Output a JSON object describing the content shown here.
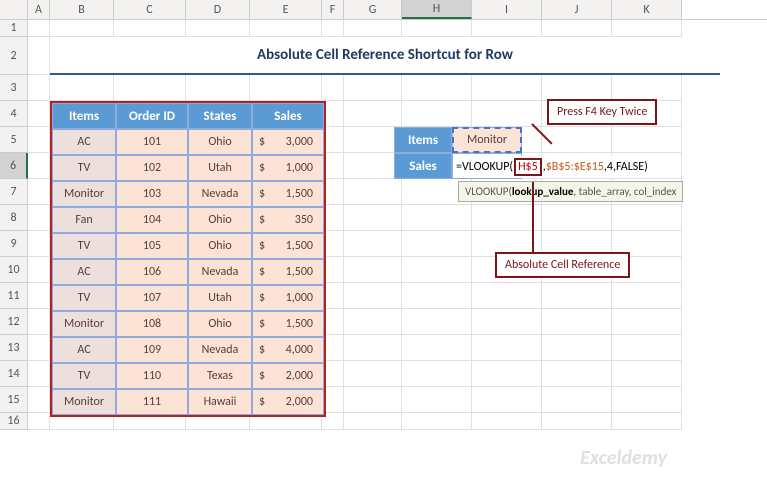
{
  "title": "Absolute Cell Reference Shortcut for Row",
  "columns": [
    "A",
    "B",
    "C",
    "D",
    "E",
    "F",
    "G",
    "H",
    "I",
    "J",
    "K"
  ],
  "row_numbers": [
    "1",
    "2",
    "3",
    "4",
    "5",
    "6",
    "7",
    "8",
    "9",
    "10",
    "11",
    "12",
    "13",
    "14",
    "15",
    "16"
  ],
  "headers": {
    "items": "Items",
    "order_id": "Order ID",
    "states": "States",
    "sales": "Sales"
  },
  "rows": [
    {
      "item": "AC",
      "order": "101",
      "state": "Ohio",
      "currency": "$",
      "sales": "3,000"
    },
    {
      "item": "TV",
      "order": "102",
      "state": "Utah",
      "currency": "$",
      "sales": "1,000"
    },
    {
      "item": "Monitor",
      "order": "103",
      "state": "Nevada",
      "currency": "$",
      "sales": "1,500"
    },
    {
      "item": "Fan",
      "order": "104",
      "state": "Ohio",
      "currency": "$",
      "sales": "350"
    },
    {
      "item": "TV",
      "order": "105",
      "state": "Ohio",
      "currency": "$",
      "sales": "1,500"
    },
    {
      "item": "AC",
      "order": "106",
      "state": "Nevada",
      "currency": "$",
      "sales": "1,500"
    },
    {
      "item": "TV",
      "order": "107",
      "state": "Utah",
      "currency": "$",
      "sales": "1,000"
    },
    {
      "item": "Monitor",
      "order": "108",
      "state": "Ohio",
      "currency": "$",
      "sales": "1,500"
    },
    {
      "item": "AC",
      "order": "109",
      "state": "Nevada",
      "currency": "$",
      "sales": "4,000"
    },
    {
      "item": "TV",
      "order": "110",
      "state": "Texas",
      "currency": "$",
      "sales": "2,000"
    },
    {
      "item": "Monitor",
      "order": "111",
      "state": "Hawaii",
      "currency": "$",
      "sales": "2,000"
    }
  ],
  "lookup": {
    "items_label": "Items",
    "sales_label": "Sales",
    "items_value": "Monitor"
  },
  "formula": {
    "prefix": "=VLOOKUP(",
    "arg1": "H$5",
    "sep": ",",
    "arg2": "$B$5:$E$15",
    "rest": ",4,FALSE)"
  },
  "tooltip": {
    "fn": "VLOOKUP(",
    "active": "lookup_value",
    "rest": ", table_array, col_index"
  },
  "callouts": {
    "top": "Press F4 Key Twice",
    "bottom": "Absolute Cell Reference"
  },
  "watermark": "Exceldemy"
}
